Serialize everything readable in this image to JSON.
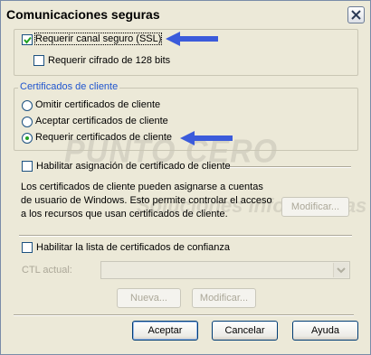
{
  "window": {
    "title": "Comunicaciones seguras",
    "close_icon": "close-icon"
  },
  "ssl": {
    "require_ssl_label": "Requerir canal seguro (SSL)",
    "require_ssl_checked": true,
    "require_128_label": "Requerir cifrado de 128 bits",
    "require_128_checked": false
  },
  "client_certs": {
    "legend": "Certificados de cliente",
    "options": [
      {
        "label": "Omitir certificados de cliente",
        "selected": false
      },
      {
        "label": "Aceptar certificados de cliente",
        "selected": false
      },
      {
        "label": "Requerir certificados de cliente",
        "selected": true
      }
    ]
  },
  "mapping": {
    "enable_label": "Habilitar asignación de certificado de cliente",
    "enable_checked": false,
    "description": [
      "Los certificados de cliente pueden asignarse a cuentas",
      "de usuario de Windows. Esto permite controlar el acceso",
      "a los recursos que usan certificados de cliente."
    ],
    "modify_button": "Modificar..."
  },
  "ctl": {
    "enable_label": "Habilitar la lista de certificados de confianza",
    "enable_checked": false,
    "current_label": "CTL actual:",
    "current_value": "",
    "new_button": "Nueva...",
    "modify_button": "Modificar..."
  },
  "footer": {
    "accept": "Aceptar",
    "cancel": "Cancelar",
    "help": "Ayuda"
  },
  "watermark": {
    "line1": "PUNTO CERO INFORMÁTICA",
    "line2": "Soluciones Informáticas"
  },
  "colors": {
    "arrow": "#3b5bdb",
    "legend": "#1f55cf",
    "check": "#21a121"
  }
}
